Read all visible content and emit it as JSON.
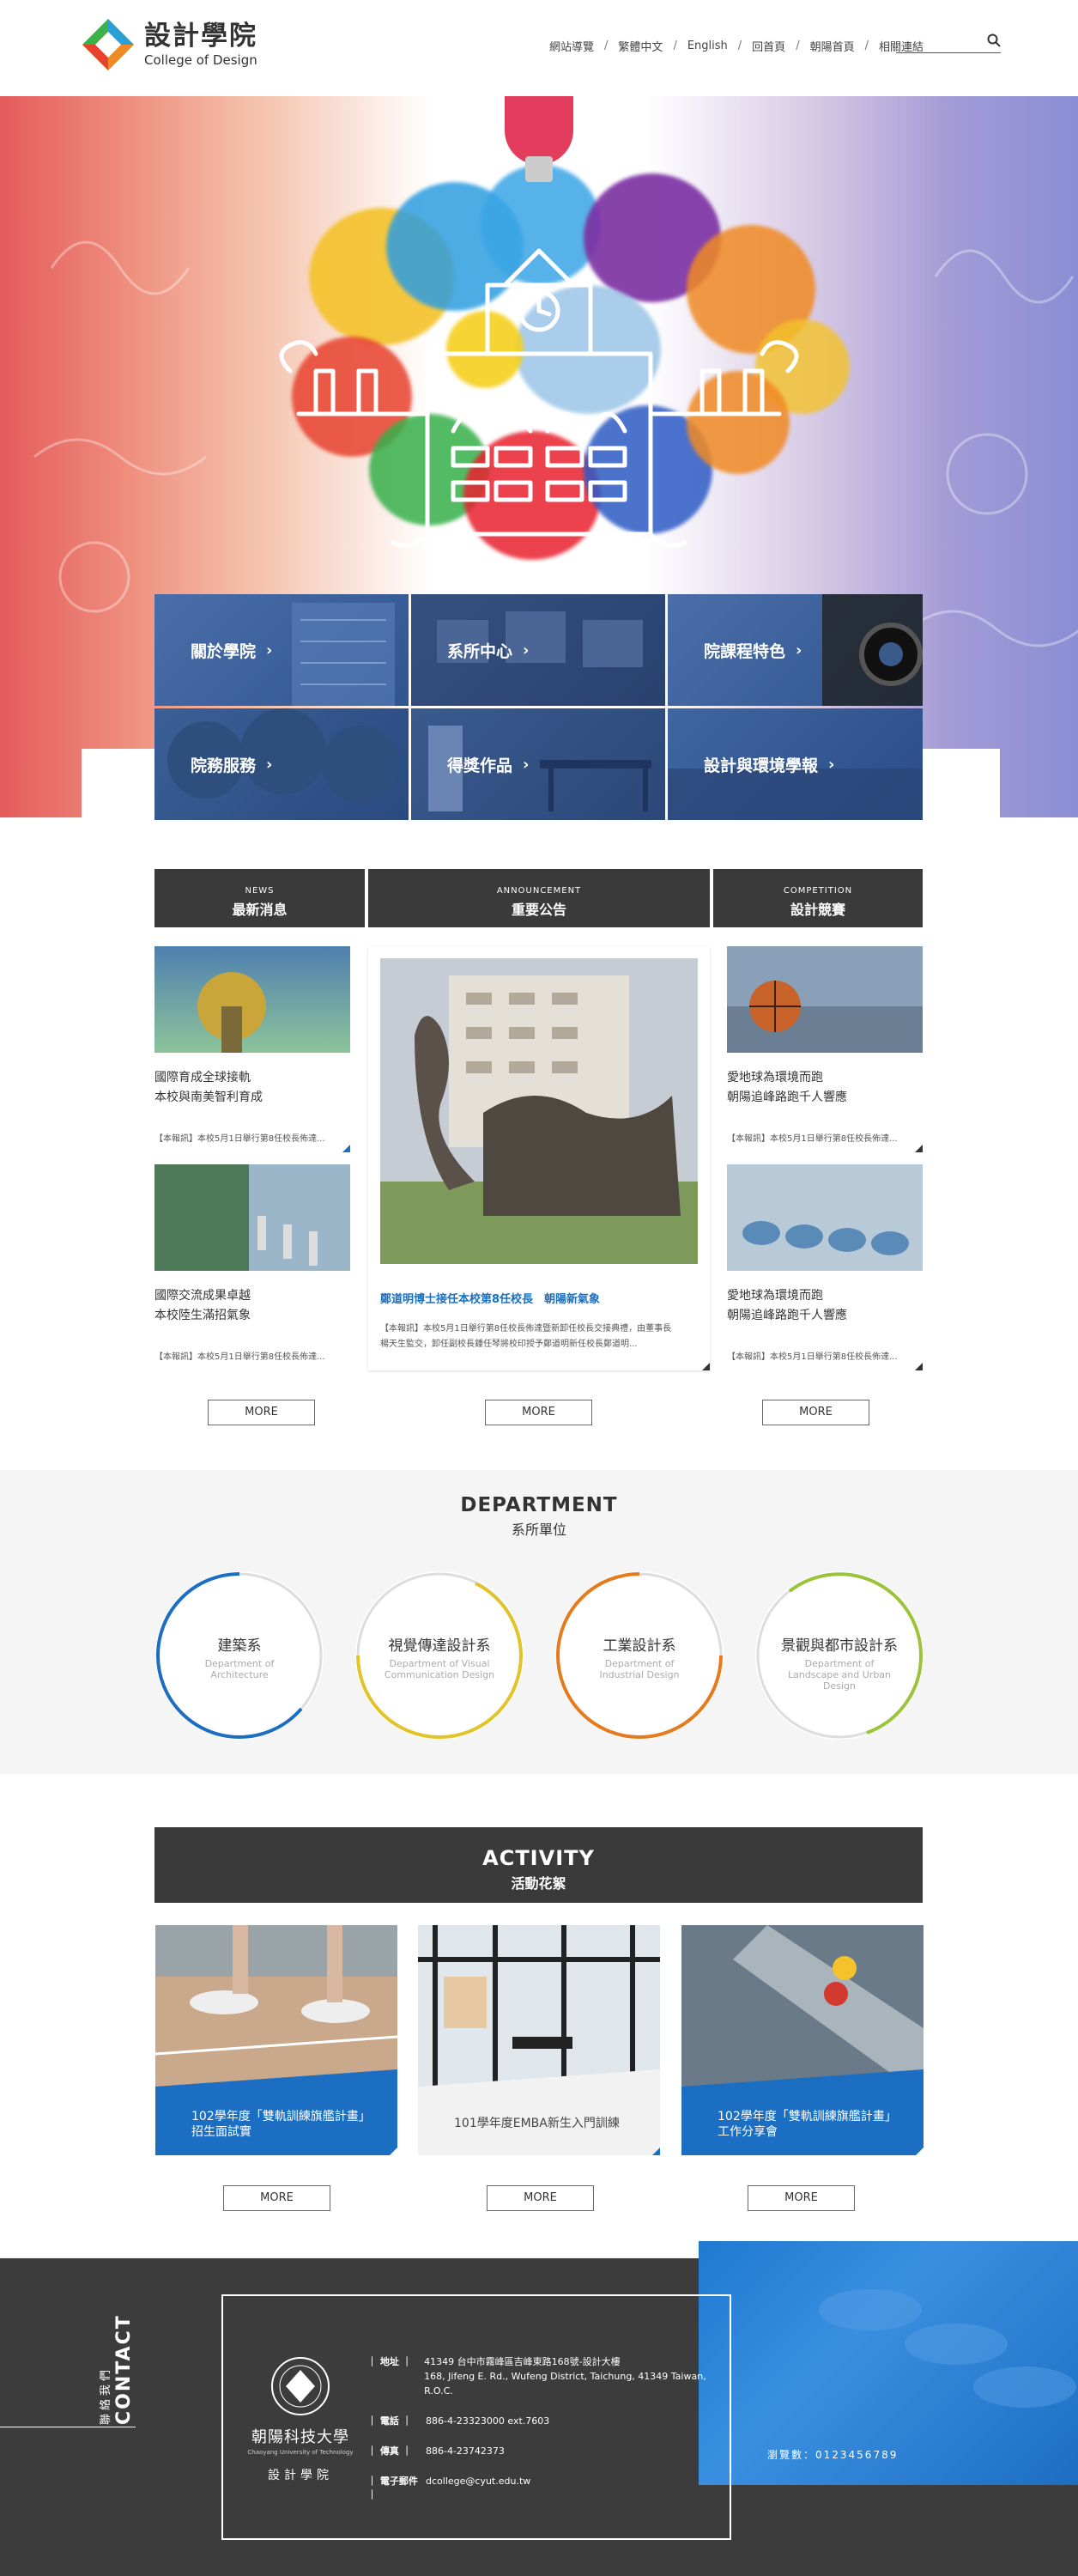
{
  "header": {
    "logo_cn": "設計學院",
    "logo_en": "College of Design",
    "nav": [
      "網站導覽",
      "繁體中文",
      "English",
      "回首頁",
      "朝陽首頁",
      "相關連結"
    ],
    "search_placeholder": ""
  },
  "tiles": [
    {
      "label": "關於學院"
    },
    {
      "label": "系所中心"
    },
    {
      "label": "院課程特色"
    },
    {
      "label": "院務服務"
    },
    {
      "label": "得獎作品"
    },
    {
      "label": "設計與環境學報"
    }
  ],
  "news": {
    "columns": [
      {
        "en": "NEWS",
        "cn": "最新消息"
      },
      {
        "en": "ANNOUNCEMENT",
        "cn": "重要公告"
      },
      {
        "en": "COMPETITION",
        "cn": "設計競賽"
      }
    ],
    "col1": [
      {
        "title1": "國際育成全球接軌",
        "title2": "本校與南美智利育成",
        "excerpt": "【本報訊】本校5月1日舉行第8任校長佈達..."
      },
      {
        "title1": "國際交流成果卓越",
        "title2": "本校陸生滿招氣象",
        "excerpt": "【本報訊】本校5月1日舉行第8任校長佈達..."
      }
    ],
    "feature": {
      "title": "鄭道明博士接任本校第8任校長　朝陽新氣象",
      "excerpt1": "【本報訊】本校5月1日舉行第8任校長佈達暨新卸任校長交接典禮，由董事長",
      "excerpt2": "楊天生監交，卸任副校長鍾任琴將校印授予鄭道明新任校長鄭道明..."
    },
    "col3": [
      {
        "title1": "愛地球為環境而跑",
        "title2": "朝陽追峰路跑千人響應",
        "excerpt": "【本報訊】本校5月1日舉行第8任校長佈達..."
      },
      {
        "title1": "愛地球為環境而跑",
        "title2": "朝陽追峰路跑千人響應",
        "excerpt": "【本報訊】本校5月1日舉行第8任校長佈達..."
      }
    ],
    "more": "MORE"
  },
  "department": {
    "title_en": "DEPARTMENT",
    "title_cn": "系所單位",
    "items": [
      {
        "cn": "建築系",
        "en": "Department of Architecture",
        "color": "#1d6ec3"
      },
      {
        "cn": "視覺傳達設計系",
        "en": "Department of Visual Communication Design",
        "color": "#e2c42a"
      },
      {
        "cn": "工業設計系",
        "en": "Department of Industrial Design",
        "color": "#e57b1e"
      },
      {
        "cn": "景觀與都市設計系",
        "en": "Department of Landscape and Urban Design",
        "color": "#9cc43a"
      }
    ]
  },
  "activity": {
    "title_en": "ACTIVITY",
    "title_cn": "活動花絮",
    "items": [
      {
        "line1": "102學年度「雙軌訓練旗艦計畫」",
        "line2": "招生面試實",
        "style": "blue"
      },
      {
        "line1": "101學年度EMBA新生入門訓練",
        "line2": "",
        "style": "grey"
      },
      {
        "line1": "102學年度「雙軌訓練旗艦計畫」",
        "line2": "工作分享會",
        "style": "blue"
      }
    ],
    "more": "MORE"
  },
  "contact": {
    "label_cn": "聯絡我們",
    "label_en": "CONTACT",
    "uni_cn": "朝陽科技大學",
    "uni_en": "Chaoyang University of Technology",
    "uni_dept": "設計學院",
    "rows": [
      {
        "label": "｜ 地址 ｜",
        "value1": "41349 台中市霧峰區吉峰東路168號-設計大樓",
        "value2": "168, Jifeng E. Rd., Wufeng District, Taichung, 41349 Taiwan, R.O.C."
      },
      {
        "label": "｜ 電話 ｜",
        "value1": "886-4-23323000 ext.7603",
        "value2": ""
      },
      {
        "label": "｜ 傳真 ｜",
        "value1": "886-4-23742373",
        "value2": ""
      },
      {
        "label": "｜ 電子郵件 ｜",
        "value1": "dcollege@cyut.edu.tw",
        "value2": ""
      }
    ],
    "visitor": "瀏覽數：0123456789"
  }
}
